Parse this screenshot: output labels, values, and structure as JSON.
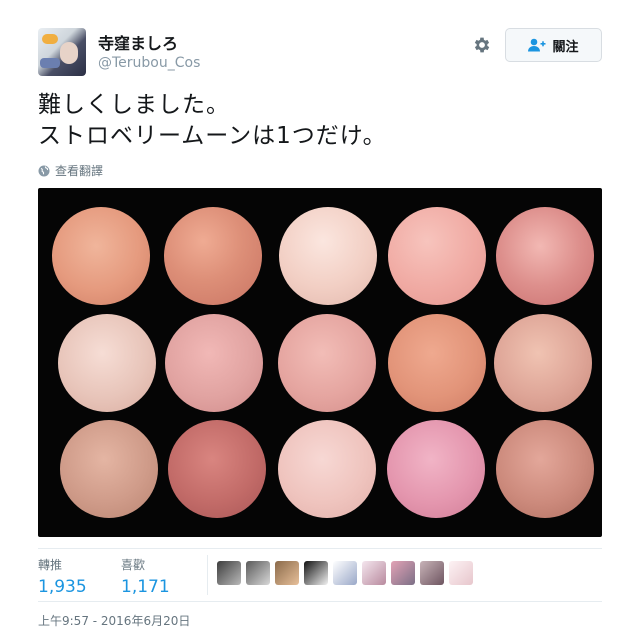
{
  "tweet": {
    "display_name": "寺窪ましろ",
    "handle": "@Terubou_Cos",
    "text_lines": [
      "難しくしました。",
      "ストロベリームーンは1つだけ。"
    ],
    "translate_label": "查看翻譯",
    "timestamp": "上午9:57 - 2016年6月20日"
  },
  "actions": {
    "follow_label": "關注"
  },
  "stats": {
    "retweets_label": "轉推",
    "retweets_count": "1,935",
    "likes_label": "喜歡",
    "likes_count": "1,171"
  },
  "colors": {
    "link": "#1b95e0",
    "muted": "#66757f",
    "media_background": "#050505"
  },
  "icons": [
    "gear-icon",
    "follow-user-icon",
    "globe-icon"
  ]
}
